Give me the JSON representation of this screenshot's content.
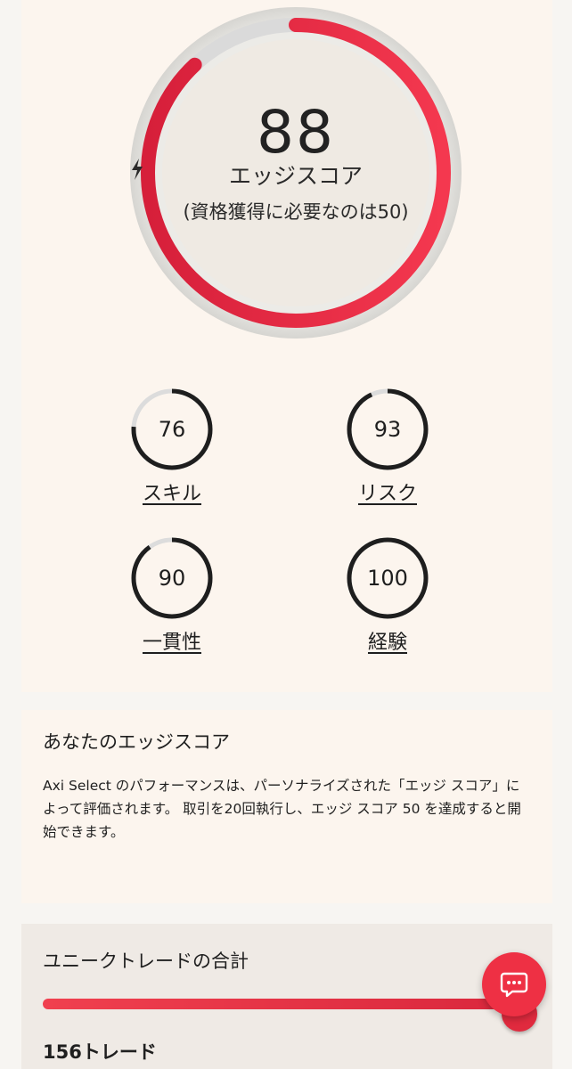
{
  "edge_score": {
    "value": "88",
    "progress": 0.88,
    "label_left": "エッジ",
    "label_right": "スコア",
    "requirement": "(資格獲得に必要なのは50)",
    "colors": {
      "arc": "#e62a3f",
      "track": "#d9d9d9"
    }
  },
  "sub_scores": [
    {
      "key": "skill",
      "value": "76",
      "progress": 0.76,
      "label": "スキル"
    },
    {
      "key": "risk",
      "value": "93",
      "progress": 0.93,
      "label": "リスク"
    },
    {
      "key": "consistency",
      "value": "90",
      "progress": 0.9,
      "label": "一貫性"
    },
    {
      "key": "experience",
      "value": "100",
      "progress": 1.0,
      "label": "経験"
    }
  ],
  "description": {
    "title": "あなたのエッジスコア",
    "body": "Axi Select のパフォーマンスは、パーソナライズされた「エッジ スコア」によって評価されます。 取引を20回執行し、エッジ スコア 50 を達成すると開始できます。"
  },
  "trades": {
    "title": "ユニークトレードの合計",
    "count": "156トレード",
    "progress": 1.0
  }
}
